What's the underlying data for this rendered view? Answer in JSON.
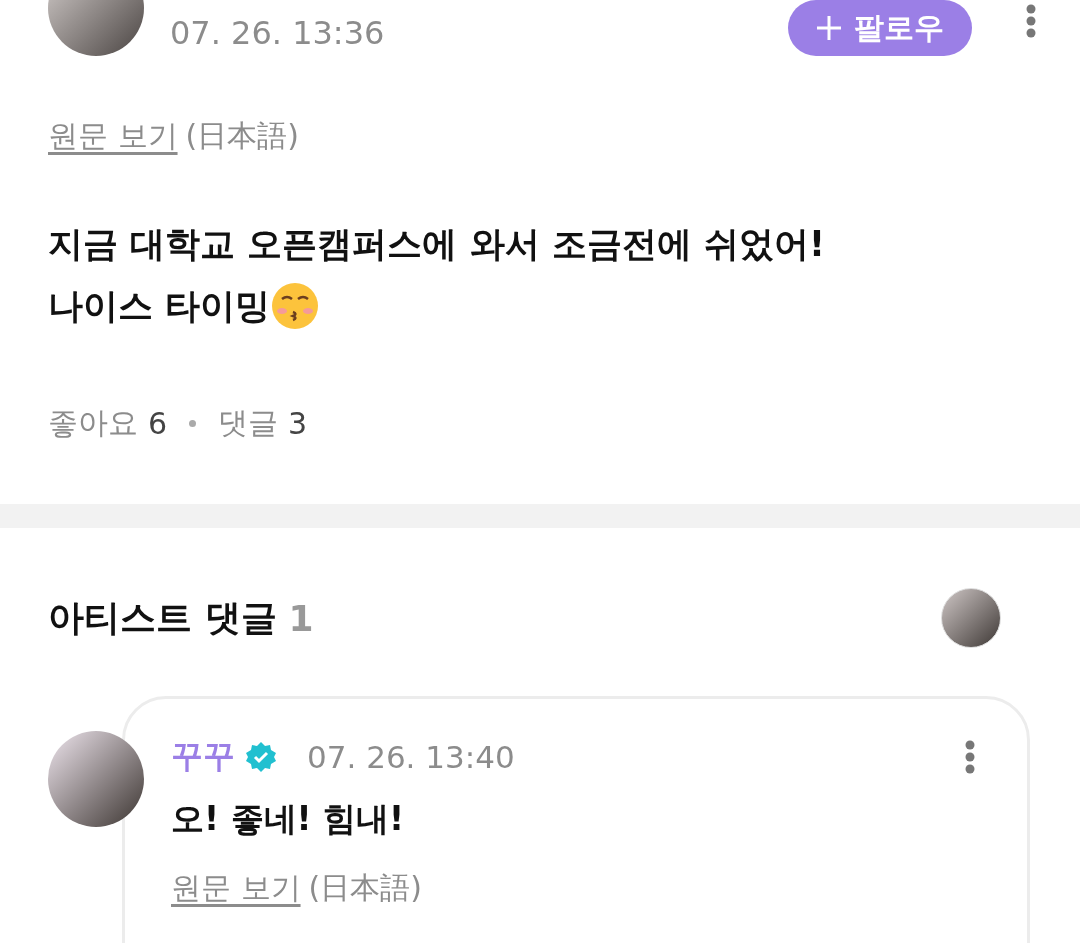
{
  "post": {
    "date": "07. 26. 13:36",
    "follow_button": "팔로우",
    "translation": {
      "link": "원문 보기",
      "language": "(日本語)"
    },
    "body_lines": [
      "지금 대학교 오픈캠퍼스에 와서 조금전에 쉬었어!",
      "나이스 타이밍"
    ],
    "stats": [
      {
        "label": "좋아요",
        "count": "6"
      },
      {
        "label": "댓글",
        "count": "3"
      }
    ]
  },
  "artist_comments": {
    "title": "아티스트 댓글",
    "count": "1",
    "comments": [
      {
        "author": "꾸꾸",
        "verified": true,
        "date": "07. 26. 13:40",
        "text": "오! 좋네! 힘내!",
        "translation": {
          "link": "원문 보기",
          "language": "(日本語)"
        }
      }
    ]
  }
}
